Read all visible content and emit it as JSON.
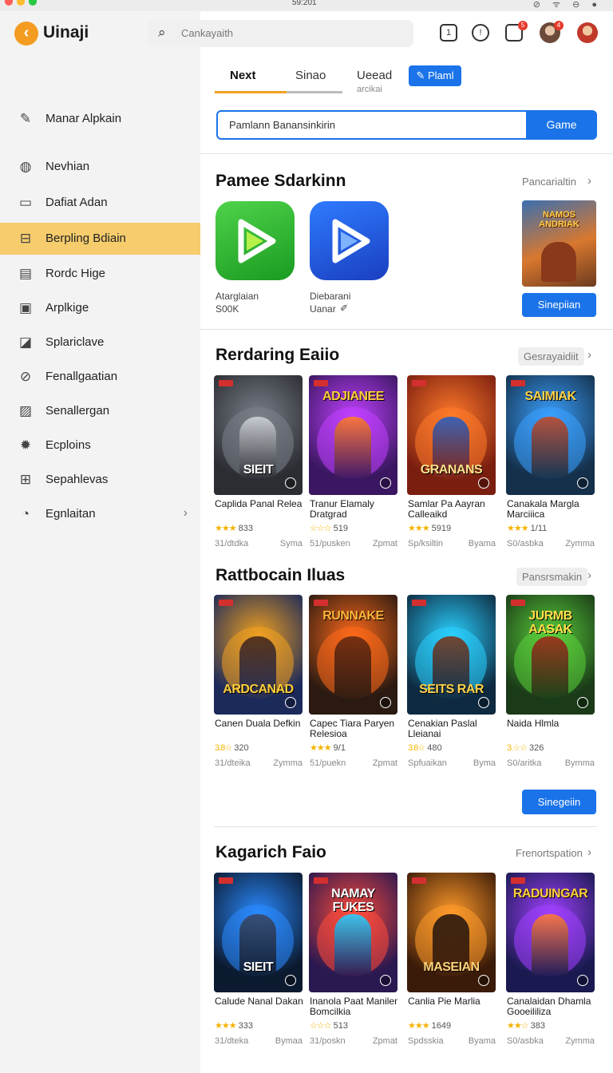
{
  "titlebar": {
    "time": "59:201"
  },
  "app": {
    "name": "Uinaji"
  },
  "search": {
    "placeholder": "Cankayaith"
  },
  "sidebar": {
    "items": [
      {
        "label": "Manar Alpkain",
        "icon": "pencil-icon"
      },
      {
        "label": "Nevhian",
        "icon": "globe-icon"
      },
      {
        "label": "Dafiat Adan",
        "icon": "archive-icon"
      },
      {
        "label": "Berpling Bdiain",
        "icon": "briefcase-icon"
      },
      {
        "label": "Rordc Hige",
        "icon": "keyboard-icon"
      },
      {
        "label": "Arplkige",
        "icon": "square-icon"
      },
      {
        "label": "Splariclave",
        "icon": "image-icon"
      },
      {
        "label": "Fenallgaatian",
        "icon": "link-icon"
      },
      {
        "label": "Senallergan",
        "icon": "gallery-icon"
      },
      {
        "label": "Ecploins",
        "icon": "bug-icon"
      },
      {
        "label": "Sepahlevas",
        "icon": "grid-icon"
      },
      {
        "label": "Egnlaitan",
        "icon": "clock-icon"
      }
    ]
  },
  "topbar": {
    "badge1": "5",
    "badge2": "4"
  },
  "tabs": {
    "t1": "Next",
    "t2": "Sinao",
    "t3": "Ueead",
    "t3_sub": "arcikai",
    "button": "Plaml"
  },
  "hero": {
    "value": "Pamlann Banansinkirin",
    "button": "Game"
  },
  "section1": {
    "title": "Pamee Sdarkinn",
    "link": "Pancarialtin",
    "apps": [
      {
        "name": "Atarglaian",
        "sub": "S00K"
      },
      {
        "name": "Diebarani",
        "sub": "Uanar"
      }
    ],
    "featured_title": "NAMOS ANDRIAK",
    "button": "Sinepiian"
  },
  "section2": {
    "title": "Rerdaring Eaiio",
    "link": "Gesrayaidiit",
    "cards": [
      {
        "art": "SIEIT",
        "name": "Caplida Panal Relear",
        "rating_value": "833",
        "stars": "★★★",
        "meta_l": "31/dtdka",
        "meta_r": "Syma"
      },
      {
        "art": "ADJIANEE",
        "name": "Tranur Elamaly Dratgrad",
        "rating_value": "519",
        "stars": "☆☆☆",
        "meta_l": "51/pusken",
        "meta_r": "Zpmat"
      },
      {
        "art": "GRANANS",
        "name": "Samlar Pa Aayran Calleaikd",
        "rating_value": "5919",
        "stars": "★★★",
        "meta_l": "Sp/ksiltin",
        "meta_r": "Byama"
      },
      {
        "art": "SAIMIAK",
        "name": "Canakala Margla Marciiica",
        "rating_value": "1/11",
        "stars": "★★★",
        "meta_l": "S0/asbka",
        "meta_r": "Zymma"
      }
    ]
  },
  "section3": {
    "title": "Rattbocain Iluas",
    "link": "Pansrsmakin",
    "cards": [
      {
        "art": "ARDCANAD",
        "name": "Canen Duala Defkin",
        "rating_value": "320",
        "stars": "3.8☆",
        "meta_l": "31/dteika",
        "meta_r": "Zymma"
      },
      {
        "art": "RUNNAKE",
        "name": "Capec Tiara Paryen Relesioa",
        "rating_value": "9/1",
        "stars": "★★★",
        "meta_l": "51/puekn",
        "meta_r": "Zpmat"
      },
      {
        "art": "SEITS RAR",
        "name": "Cenakian Paslal Lleianai",
        "rating_value": "480",
        "stars": "3.6☆",
        "meta_l": "Spfuaikan",
        "meta_r": "Byma"
      },
      {
        "art": "JURMB AASAK",
        "name": "Naida Hlmla",
        "rating_value": "326",
        "stars": "3.☆☆",
        "meta_l": "S0/aritka",
        "meta_r": "Bymma"
      }
    ],
    "button": "Sinegeiin"
  },
  "section4": {
    "title": "Kagarich Faio",
    "link": "Frenortspation",
    "cards": [
      {
        "art": "SIEIT",
        "name": "Calude Nanal Dakan",
        "rating_value": "333",
        "stars": "★★★",
        "meta_l": "31/dteka",
        "meta_r": "Bymaa"
      },
      {
        "art": "NAMAY FUKES",
        "name": "Inanola Paat Manilen Bomcilkia",
        "rating_value": "513",
        "stars": "☆☆☆",
        "meta_l": "31/poskn",
        "meta_r": "Zpmat"
      },
      {
        "art": "MASEIAN",
        "name": "Canlia Pie Marlia",
        "rating_value": "1649",
        "stars": "★★★",
        "meta_l": "Spdsskia",
        "meta_r": "Byama"
      },
      {
        "art": "RADUINGAR",
        "name": "Canalaidan Dhamla Gooeililiza",
        "rating_value": "383",
        "stars": "★★☆",
        "meta_l": "S0/asbka",
        "meta_r": "Zymma"
      }
    ]
  },
  "colors": {
    "accent": "#1a73e8",
    "active_nav": "#f6cc6c",
    "logo": "#f39c21",
    "star": "#f5b301"
  }
}
